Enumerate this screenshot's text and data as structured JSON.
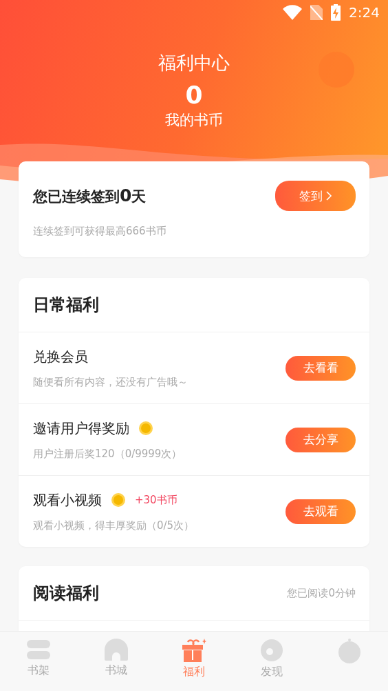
{
  "status_bar": {
    "time": "2:24"
  },
  "header": {
    "title": "福利中心",
    "coins": "0",
    "coins_label": "我的书币"
  },
  "sign_in": {
    "title": "您已连续签到**0**天",
    "subtitle": "连续签到可获得最高666书币",
    "button": "签到"
  },
  "daily": {
    "title": "日常福利",
    "tasks": [
      {
        "title": "兑换会员",
        "coin": false,
        "desc": "随便看所有内容，还没有广告哦～",
        "button": "去看看"
      },
      {
        "title": "邀请用户得奖励",
        "coin": true,
        "desc": "用户注册后奖120（0/9999次）",
        "button": "去分享"
      },
      {
        "title": "观看小视频",
        "coin": true,
        "reward": "+30书币",
        "desc": "观看小视频，得丰厚奖励（0/5次）",
        "button": "去观看"
      }
    ]
  },
  "reading": {
    "title": "阅读福利",
    "note": "您已阅读0分钟"
  },
  "tabs": [
    {
      "kind": "shelf",
      "label": "书架",
      "selected": false
    },
    {
      "kind": "store",
      "label": "书城",
      "selected": false
    },
    {
      "kind": "gift",
      "label": "福利",
      "selected": true
    },
    {
      "kind": "discover",
      "label": "发现",
      "selected": false
    },
    {
      "kind": "profile",
      "selected": false
    }
  ]
}
